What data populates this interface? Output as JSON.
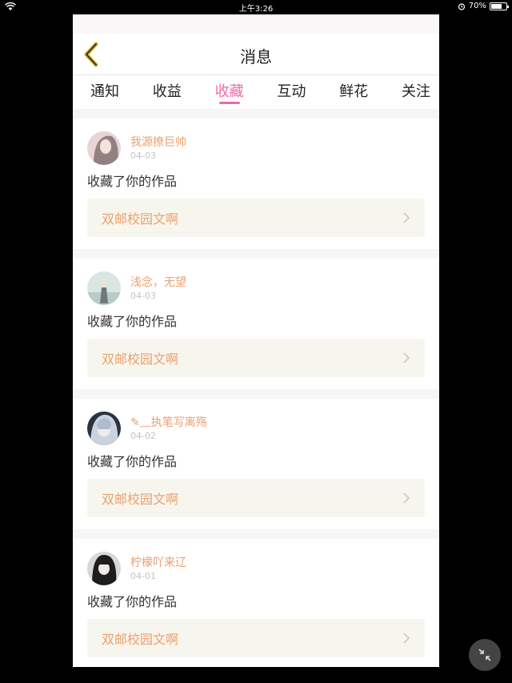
{
  "status_bar": {
    "time": "上午3:26",
    "battery": "70%",
    "battery_level": 0.7
  },
  "header": {
    "title": "消息",
    "back_icon": "chevron-left-icon"
  },
  "tabs": [
    {
      "label": "通知",
      "active": false
    },
    {
      "label": "收益",
      "active": false
    },
    {
      "label": "收藏",
      "active": true
    },
    {
      "label": "互动",
      "active": false
    },
    {
      "label": "鲜花",
      "active": false
    },
    {
      "label": "关注",
      "active": false
    }
  ],
  "colors": {
    "accent": "#ee6aa7",
    "name": "#e9a06e",
    "work_bg": "#f7f6ee"
  },
  "notifications": [
    {
      "user": "我源撩巨帅",
      "date": "04-03",
      "action": "收藏了你的作品",
      "work": "双邮校园文啊"
    },
    {
      "user": "浅念，无望",
      "date": "04-03",
      "action": "收藏了你的作品",
      "work": "双邮校园文啊"
    },
    {
      "user": "✎﹏执笔写离殇",
      "date": "04-02",
      "action": "收藏了你的作品",
      "work": "双邮校园文啊"
    },
    {
      "user": "柠檬吖来辽",
      "date": "04-01",
      "action": "收藏了你的作品",
      "work": "双邮校园文啊"
    }
  ]
}
